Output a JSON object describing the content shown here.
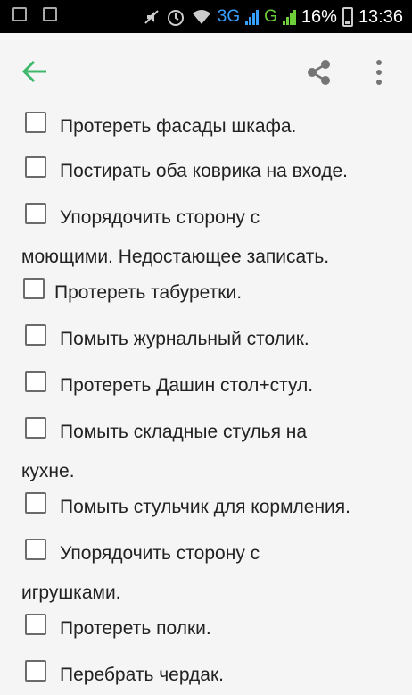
{
  "statusbar": {
    "network_3g": "3G",
    "network_g": "G",
    "battery": "16%",
    "time": "13:36"
  },
  "toolbar": {
    "back_icon": "arrow-left-icon",
    "share_icon": "share-icon",
    "menu_icon": "more-vert-icon",
    "accent_color": "#3fb86c"
  },
  "checklist": [
    {
      "text": "Протереть фасады шкафа.",
      "checked": false
    },
    {
      "text": "Постирать оба коврика на входе.",
      "checked": false
    },
    {
      "text": "Упорядочить сторону с",
      "continuation": "моющими. Недостающее записать.",
      "checked": false
    },
    {
      "text": "Протереть табуретки.",
      "checked": false
    },
    {
      "text": "Помыть журнальный столик.",
      "checked": false
    },
    {
      "text": "Протереть Дашин стол+стул.",
      "checked": false
    },
    {
      "text": "Помыть складные стулья на",
      "continuation": "кухне.",
      "checked": false
    },
    {
      "text": "Помыть стульчик для кормления.",
      "checked": false
    },
    {
      "text": "Упорядочить сторону с",
      "continuation": "игрушками.",
      "checked": false
    },
    {
      "text": "Протереть полки.",
      "checked": false
    },
    {
      "text": "Перебрать чердак.",
      "checked": false
    }
  ]
}
